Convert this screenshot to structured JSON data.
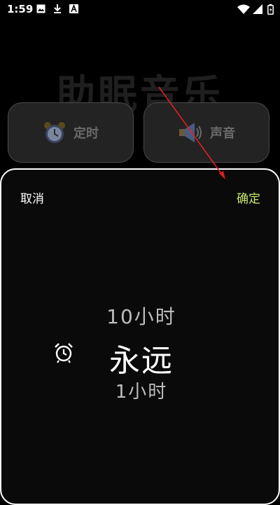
{
  "status": {
    "time": "1:59",
    "icons": [
      "image-icon",
      "download-icon",
      "app-a-icon",
      "wifi-icon",
      "signal-icon",
      "battery-icon"
    ]
  },
  "background": {
    "title": "助眠音乐",
    "cards": [
      {
        "label": "定时",
        "icon": "alarm-clock-icon"
      },
      {
        "label": "声音",
        "icon": "speaker-icon"
      }
    ]
  },
  "sheet": {
    "cancel_label": "取消",
    "confirm_label": "确定",
    "picker": {
      "prev": "10小时",
      "selected": "永远",
      "next": "1小时"
    }
  },
  "colors": {
    "accent": "#c7e86a",
    "annotation_arrow": "#e02020"
  }
}
